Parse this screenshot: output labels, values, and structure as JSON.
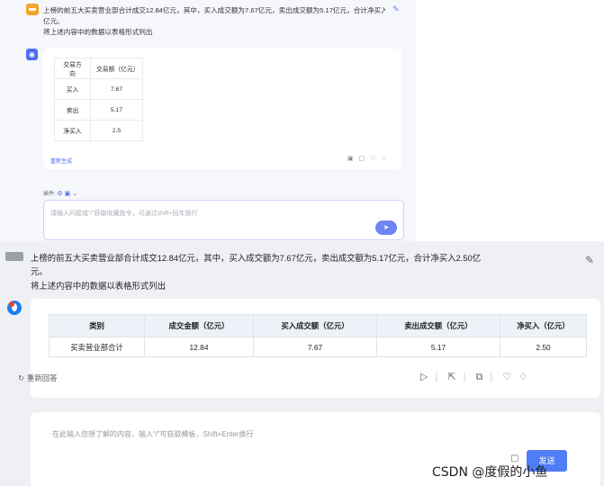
{
  "top": {
    "question_line1": "上榜的前五大买卖营业部合计成交12.84亿元，其中，买入成交额为7.67亿元，卖出成交额为5.17亿元，合计净买入2.",
    "question_line2": "亿元。",
    "question_line3": "将上述内容中的数据以表格形式列出",
    "table": {
      "headers": [
        "交易方向",
        "交易额（亿元）"
      ],
      "rows": [
        [
          "买入",
          "7.67"
        ],
        [
          "卖出",
          "5.17"
        ],
        [
          "净买入",
          "2.5"
        ]
      ]
    },
    "regen_label": "重新生成",
    "plugin_label": "插件:",
    "input_placeholder": "请输入问题或“/”获取收藏指令，可通过shift+回车换行"
  },
  "bottom": {
    "question_line1": "上榜的前五大买卖营业部合计成交12.84亿元，其中，买入成交额为7.67亿元，卖出成交额为5.17亿元，合计净买入2.50亿",
    "question_line2": "元。",
    "question_line3": "将上述内容中的数据以表格形式列出",
    "table": {
      "headers": [
        "类别",
        "成交金额（亿元）",
        "买入成交额（亿元）",
        "卖出成交额（亿元）",
        "净买入（亿元）"
      ],
      "rows": [
        [
          "买卖营业部合计",
          "12.84",
          "7.67",
          "5.17",
          "2.50"
        ]
      ]
    },
    "regen_label": "重新回答",
    "input_placeholder": "在此输入您想了解的内容，输入“/”可获取模板，Shift+Enter换行",
    "send_label": "发送"
  },
  "watermark": "CSDN @度假的小鱼"
}
